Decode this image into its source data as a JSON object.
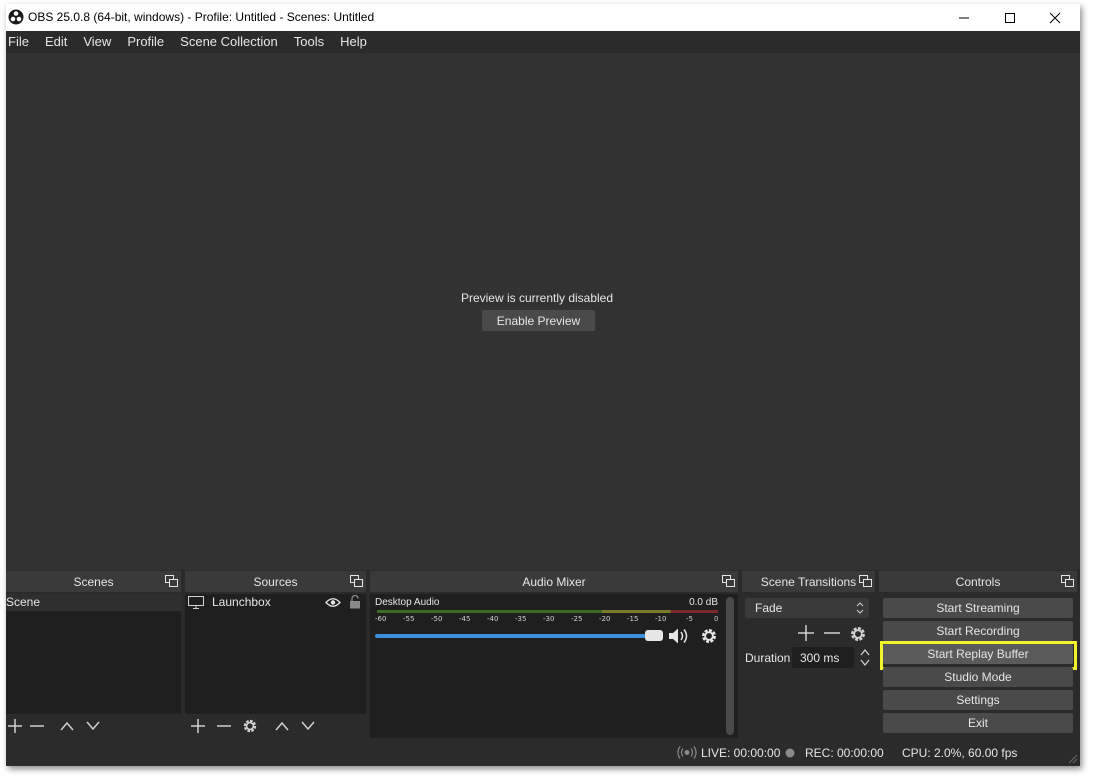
{
  "window": {
    "title": "OBS 25.0.8 (64-bit, windows) - Profile: Untitled - Scenes: Untitled",
    "app_icon": "obs-logo-icon",
    "controls": [
      "minimize-icon",
      "maximize-icon",
      "close-icon"
    ]
  },
  "menu": [
    "File",
    "Edit",
    "View",
    "Profile",
    "Scene Collection",
    "Tools",
    "Help"
  ],
  "preview": {
    "message": "Preview is currently disabled",
    "button": "Enable Preview"
  },
  "scenes": {
    "title": "Scenes",
    "items": [
      "Scene"
    ],
    "toolbar": [
      "add-icon",
      "remove-icon",
      "move-up-icon",
      "move-down-icon"
    ]
  },
  "sources": {
    "title": "Sources",
    "items": [
      {
        "name": "Launchbox",
        "icon": "display-capture-icon",
        "visible": true,
        "locked": false
      }
    ],
    "toolbar": [
      "add-icon",
      "remove-icon",
      "properties-gear-icon",
      "move-up-icon",
      "move-down-icon"
    ]
  },
  "mixer": {
    "title": "Audio Mixer",
    "channels": [
      {
        "name": "Desktop Audio",
        "level": "0.0 dB",
        "volume_fraction": 1.0
      }
    ],
    "scale": [
      "-60",
      "-55",
      "-50",
      "-45",
      "-40",
      "-35",
      "-30",
      "-25",
      "-20",
      "-15",
      "-10",
      "-5",
      "0"
    ]
  },
  "transitions": {
    "title": "Scene Transitions",
    "selected": "Fade",
    "duration_label": "Duration",
    "duration_value": "300 ms"
  },
  "controls": {
    "title": "Controls",
    "buttons": [
      "Start Streaming",
      "Start Recording",
      "Start Replay Buffer",
      "Studio Mode",
      "Settings",
      "Exit"
    ],
    "highlighted": "Start Replay Buffer",
    "highlight_color": "#f2f22a"
  },
  "status": {
    "live": "LIVE: 00:00:00",
    "rec": "REC: 00:00:00",
    "cpu": "CPU: 2.0%, 60.00 fps"
  },
  "colors": {
    "background": "#2b2b2b",
    "preview": "#323232",
    "accent_blue": "#3d8edb"
  }
}
